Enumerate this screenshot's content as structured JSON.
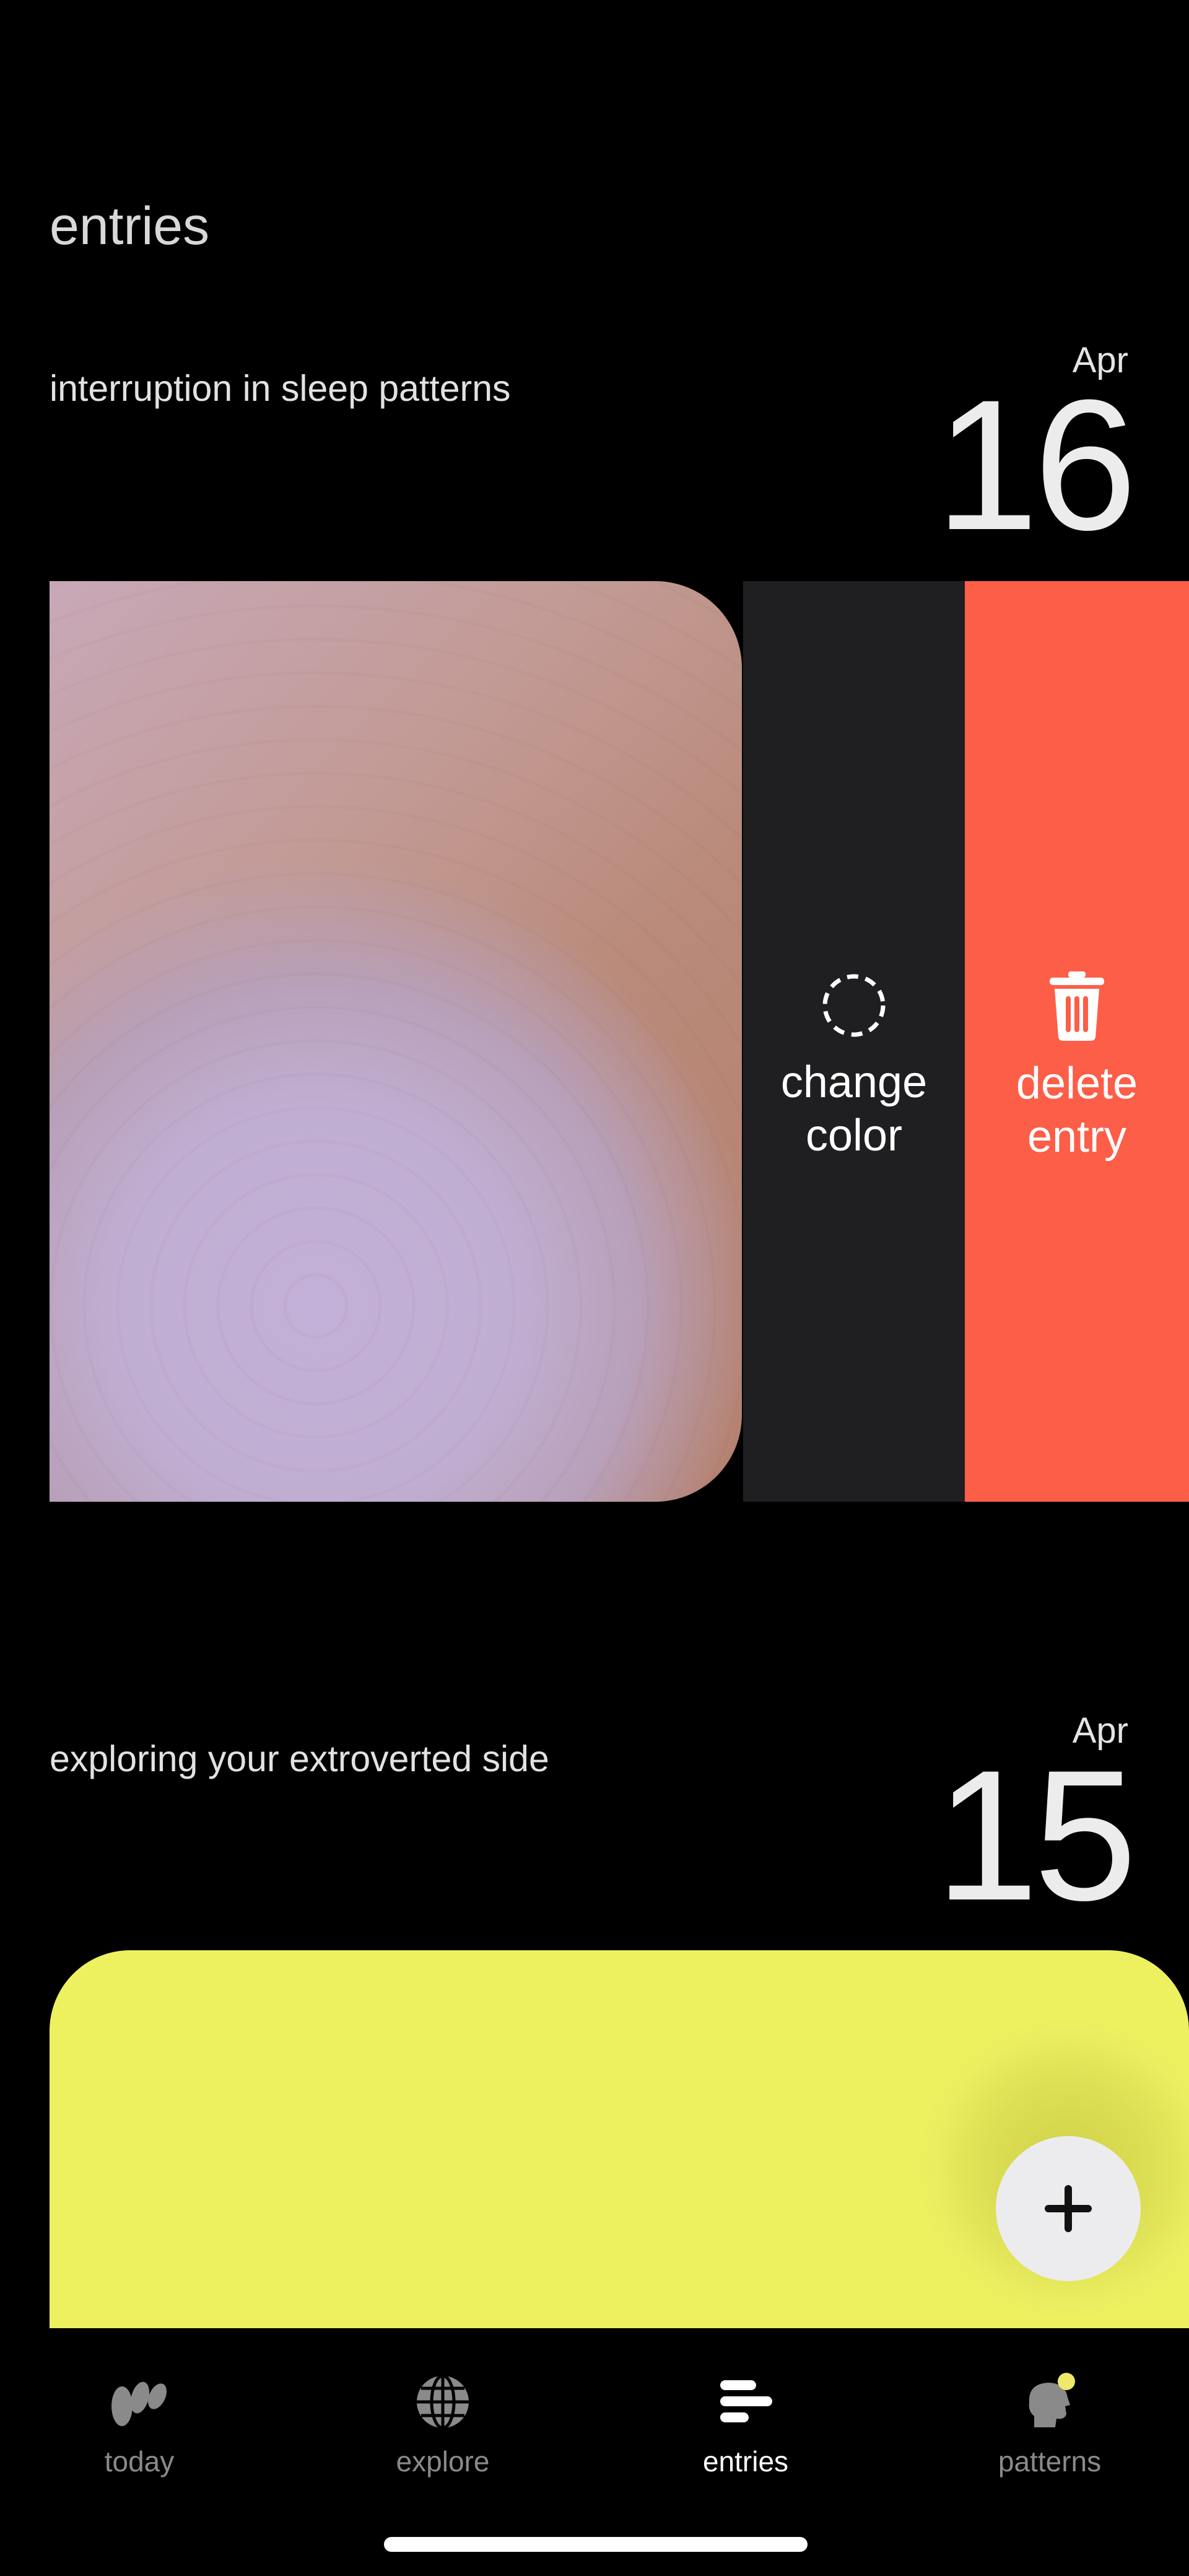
{
  "header": {
    "title": "entries"
  },
  "entries": [
    {
      "title": "interruption in sleep patterns",
      "month": "Apr",
      "day": "16"
    },
    {
      "title": "exploring your extroverted side",
      "month": "Apr",
      "day": "15"
    }
  ],
  "swipe_actions": {
    "change_color_label": "change\ncolor",
    "delete_label": "delete\nentry",
    "change_color_icon": "dashed-circle-icon",
    "delete_icon": "trash-icon"
  },
  "fab": {
    "icon": "plus-icon"
  },
  "tabbar": {
    "tabs": [
      {
        "label": "today",
        "icon": "today-logo-icon",
        "active": false
      },
      {
        "label": "explore",
        "icon": "globe-icon",
        "active": false
      },
      {
        "label": "entries",
        "icon": "entries-lines-icon",
        "active": true
      },
      {
        "label": "patterns",
        "icon": "patterns-head-icon",
        "active": false
      }
    ]
  },
  "colors": {
    "background": "#000000",
    "delete_red": "#fd5e47",
    "change_dark": "#1f1e21",
    "entry2_yellow": "#edf160",
    "patterns_dot": "#f0e86a"
  }
}
